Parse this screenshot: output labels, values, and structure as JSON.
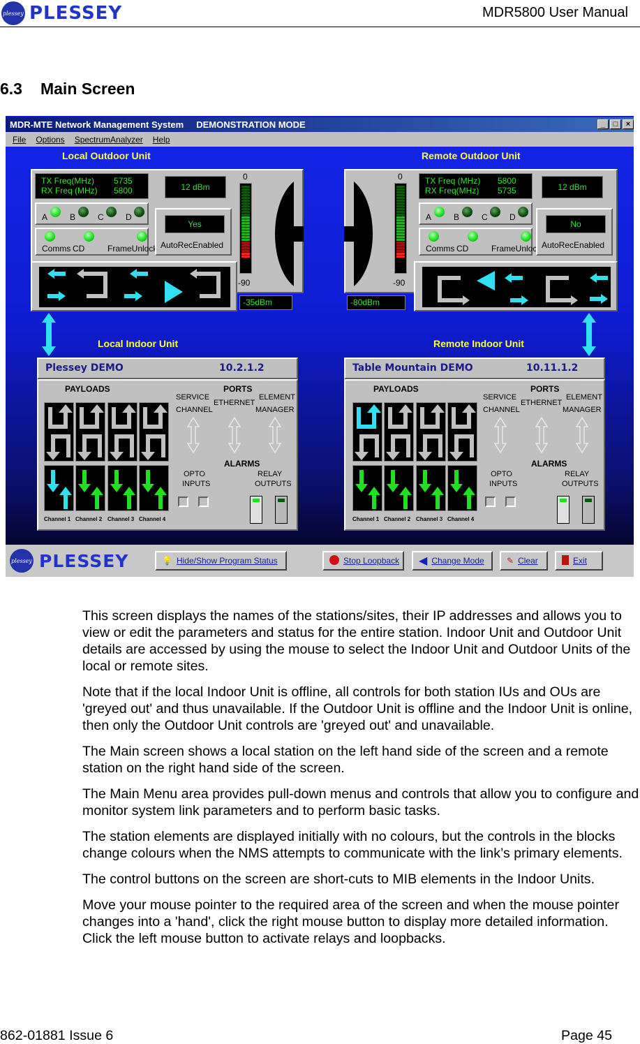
{
  "header": {
    "logo_text": "PLESSEY",
    "logo_disc_text": "plessey",
    "doc_title": "MDR5800 User Manual"
  },
  "section": {
    "number": "6.3",
    "title": "Main Screen"
  },
  "app": {
    "title": "MDR-MTE Network Management System",
    "mode": "DEMONSTRATION MODE",
    "window_buttons": [
      "_",
      "□",
      "×"
    ],
    "menu": [
      "File",
      "Options",
      "SpectrumAnalyzer",
      "Help"
    ],
    "local_outdoor": {
      "label": "Local Outdoor Unit",
      "tx_label": "TX Freq(MHz)",
      "tx_value": "5735",
      "rx_label": "RX Freq (MHz)",
      "rx_value": "5800",
      "power": "12 dBm",
      "leds": [
        {
          "label": "A",
          "on": true
        },
        {
          "label": "B",
          "on": false
        },
        {
          "label": "C",
          "on": false
        },
        {
          "label": "D",
          "on": false
        }
      ],
      "status_leds": [
        "Comms",
        "CD",
        "FrameUnlock"
      ],
      "autorec_value": "Yes",
      "autorec_label": "AutoRecEnabled",
      "meter_top": "0",
      "meter_bottom": "-90",
      "rssi": "-35dBm"
    },
    "remote_outdoor": {
      "label": "Remote Outdoor Unit",
      "tx_label": "TX Freq (MHz)",
      "tx_value": "5800",
      "rx_label": "RX Freq(MHz)",
      "rx_value": "5735",
      "power": "12 dBm",
      "leds": [
        {
          "label": "A",
          "on": true
        },
        {
          "label": "B",
          "on": false
        },
        {
          "label": "C",
          "on": false
        },
        {
          "label": "D",
          "on": false
        }
      ],
      "status_leds": [
        "Comms",
        "CD",
        "FrameUnlock"
      ],
      "autorec_value": "No",
      "autorec_label": "AutoRecEnabled",
      "meter_top": "0",
      "meter_bottom": "-90",
      "rssi": "-80dBm"
    },
    "local_indoor": {
      "label": "Local Indoor Unit",
      "name": "Plessey DEMO",
      "ip": "10.2.1.2",
      "channel_colors": [
        "#30e0f0",
        "#20e020",
        "#20e020",
        "#20e020"
      ]
    },
    "remote_indoor": {
      "label": "Remote Indoor Unit",
      "name": "Table Mountain DEMO",
      "ip": "10.11.1.2",
      "channel_colors": [
        "#20e020",
        "#20e020",
        "#20e020",
        "#20e020"
      ],
      "first_loop_color": "#30e0f0"
    },
    "indoor_labels": {
      "payloads": "PAYLOADS",
      "ports": "PORTS",
      "service": "SERVICE",
      "channel": "CHANNEL",
      "ethernet": "ETHERNET",
      "element": "ELEMENT",
      "manager": "MANAGER",
      "alarms": "ALARMS",
      "opto": "OPTO",
      "inputs": "INPUTS",
      "relay": "RELAY",
      "outputs": "OUTPUTS",
      "channels": [
        "Channel 1",
        "Channel 2",
        "Channel 3",
        "Channel 4"
      ]
    },
    "bottom": {
      "logo_text": "PLESSEY",
      "buttons": [
        {
          "label": "Hide/Show Program Status",
          "icon": "lightbulb-icon"
        },
        {
          "label": "Stop Loopback",
          "icon": "stop-icon"
        },
        {
          "label": "Change Mode",
          "icon": "back-arrow-icon"
        },
        {
          "label": "Clear",
          "icon": "clear-icon"
        },
        {
          "label": "Exit",
          "icon": "exit-icon"
        }
      ]
    }
  },
  "body": [
    "This screen displays the names of the stations/sites, their IP addresses and allows you to view or edit the parameters and status for the entire station.  Indoor Unit and Outdoor Unit details are accessed by using the mouse to select the Indoor Unit and Outdoor Units of the local or remote sites.",
    "Note that if the local Indoor Unit is offline, all controls for both station IUs and OUs are 'greyed out' and thus unavailable.  If the Outdoor Unit is offline and the Indoor Unit is online, then only the Outdoor Unit controls are 'greyed out' and unavailable.",
    "The Main screen shows a local station on the left hand side of the screen and a remote station on the right hand side of the screen.",
    "The Main Menu area provides pull-down menus and controls that allow you to configure and monitor system link parameters and to perform basic tasks.",
    "The station elements are displayed initially with no colours, but the controls in the blocks change colours when the NMS attempts to communicate with the link’s primary elements.",
    "The control buttons on the screen are short-cuts to MIB elements in the Indoor Units.",
    "Move your mouse pointer to the required area of the screen and when the mouse pointer changes into a 'hand', click the right mouse button to display more detailed information.  Click the left mouse button to activate relays and loopbacks."
  ],
  "footer": {
    "left": "862-01881 Issue 6",
    "right": "Page 45"
  }
}
